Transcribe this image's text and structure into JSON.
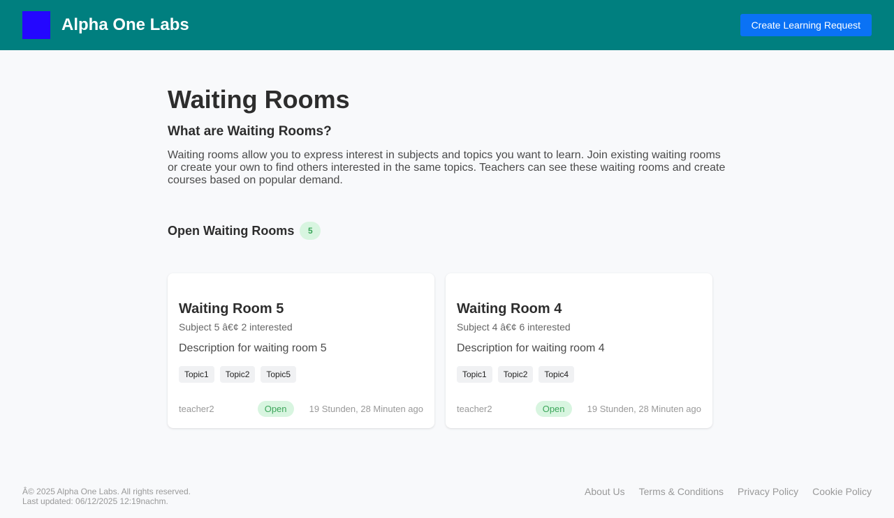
{
  "header": {
    "brand": "Alpha One Labs",
    "cta_label": "Create Learning Request",
    "logo_color": "#2407ff",
    "bg_color": "#007f7f"
  },
  "main": {
    "title": "Waiting Rooms",
    "subtitle": "What are Waiting Rooms?",
    "intro": "Waiting rooms allow you to express interest in subjects and topics you want to learn. Join existing waiting rooms or create your own to find others interested in the same topics. Teachers can see these waiting rooms and create courses based on popular demand.",
    "open_title": "Open Waiting Rooms",
    "open_count": "5"
  },
  "rooms": [
    {
      "title": "Waiting Room 5",
      "meta": "Subject 5 â€¢ 2 interested",
      "description": "Description for waiting room 5",
      "tags": [
        "Topic1",
        "Topic2",
        "Topic5"
      ],
      "teacher": "teacher2",
      "status": "Open",
      "time": "19 Stunden, 28 Minuten ago"
    },
    {
      "title": "Waiting Room 4",
      "meta": "Subject 4 â€¢ 6 interested",
      "description": "Description for waiting room 4",
      "tags": [
        "Topic1",
        "Topic2",
        "Topic4"
      ],
      "teacher": "teacher2",
      "status": "Open",
      "time": "19 Stunden, 28 Minuten ago"
    }
  ],
  "footer": {
    "copyright": "Â© 2025 Alpha One Labs. All rights reserved.",
    "updated": "Last updated: 06/12/2025 12:19nachm.",
    "links": [
      "About Us",
      "Terms & Conditions",
      "Privacy Policy",
      "Cookie Policy"
    ]
  }
}
